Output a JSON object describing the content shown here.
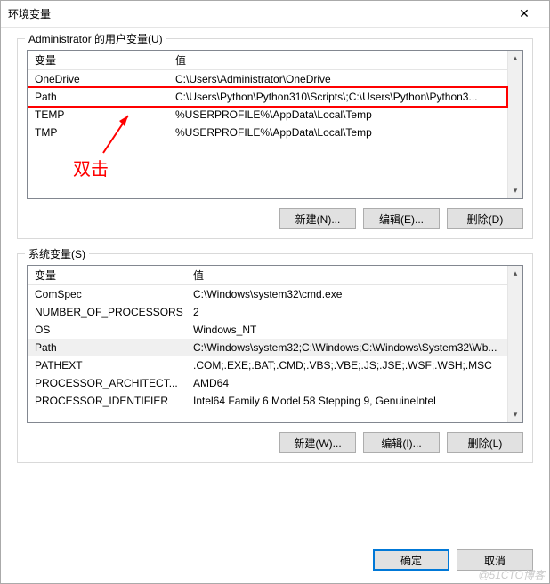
{
  "window": {
    "title": "环境变量",
    "close_glyph": "✕"
  },
  "user_group": {
    "label": "Administrator 的用户变量(U)",
    "head_var": "变量",
    "head_val": "值",
    "rows": [
      {
        "var": "OneDrive",
        "val": "C:\\Users\\Administrator\\OneDrive"
      },
      {
        "var": "Path",
        "val": "C:\\Users\\Python\\Python310\\Scripts\\;C:\\Users\\Python\\Python3..."
      },
      {
        "var": "TEMP",
        "val": "%USERPROFILE%\\AppData\\Local\\Temp"
      },
      {
        "var": "TMP",
        "val": "%USERPROFILE%\\AppData\\Local\\Temp"
      }
    ],
    "buttons": {
      "new": "新建(N)...",
      "edit": "编辑(E)...",
      "del": "删除(D)"
    }
  },
  "sys_group": {
    "label": "系统变量(S)",
    "head_var": "变量",
    "head_val": "值",
    "rows": [
      {
        "var": "ComSpec",
        "val": "C:\\Windows\\system32\\cmd.exe"
      },
      {
        "var": "NUMBER_OF_PROCESSORS",
        "val": "2"
      },
      {
        "var": "OS",
        "val": "Windows_NT"
      },
      {
        "var": "Path",
        "val": "C:\\Windows\\system32;C:\\Windows;C:\\Windows\\System32\\Wb..."
      },
      {
        "var": "PATHEXT",
        "val": ".COM;.EXE;.BAT;.CMD;.VBS;.VBE;.JS;.JSE;.WSF;.WSH;.MSC"
      },
      {
        "var": "PROCESSOR_ARCHITECT...",
        "val": "AMD64"
      },
      {
        "var": "PROCESSOR_IDENTIFIER",
        "val": "Intel64 Family 6 Model 58 Stepping 9, GenuineIntel"
      }
    ],
    "buttons": {
      "new": "新建(W)...",
      "edit": "编辑(I)...",
      "del": "删除(L)"
    }
  },
  "footer": {
    "ok": "确定",
    "cancel": "取消"
  },
  "annotation": {
    "text": "双击"
  },
  "watermark": "@51CTO博客"
}
